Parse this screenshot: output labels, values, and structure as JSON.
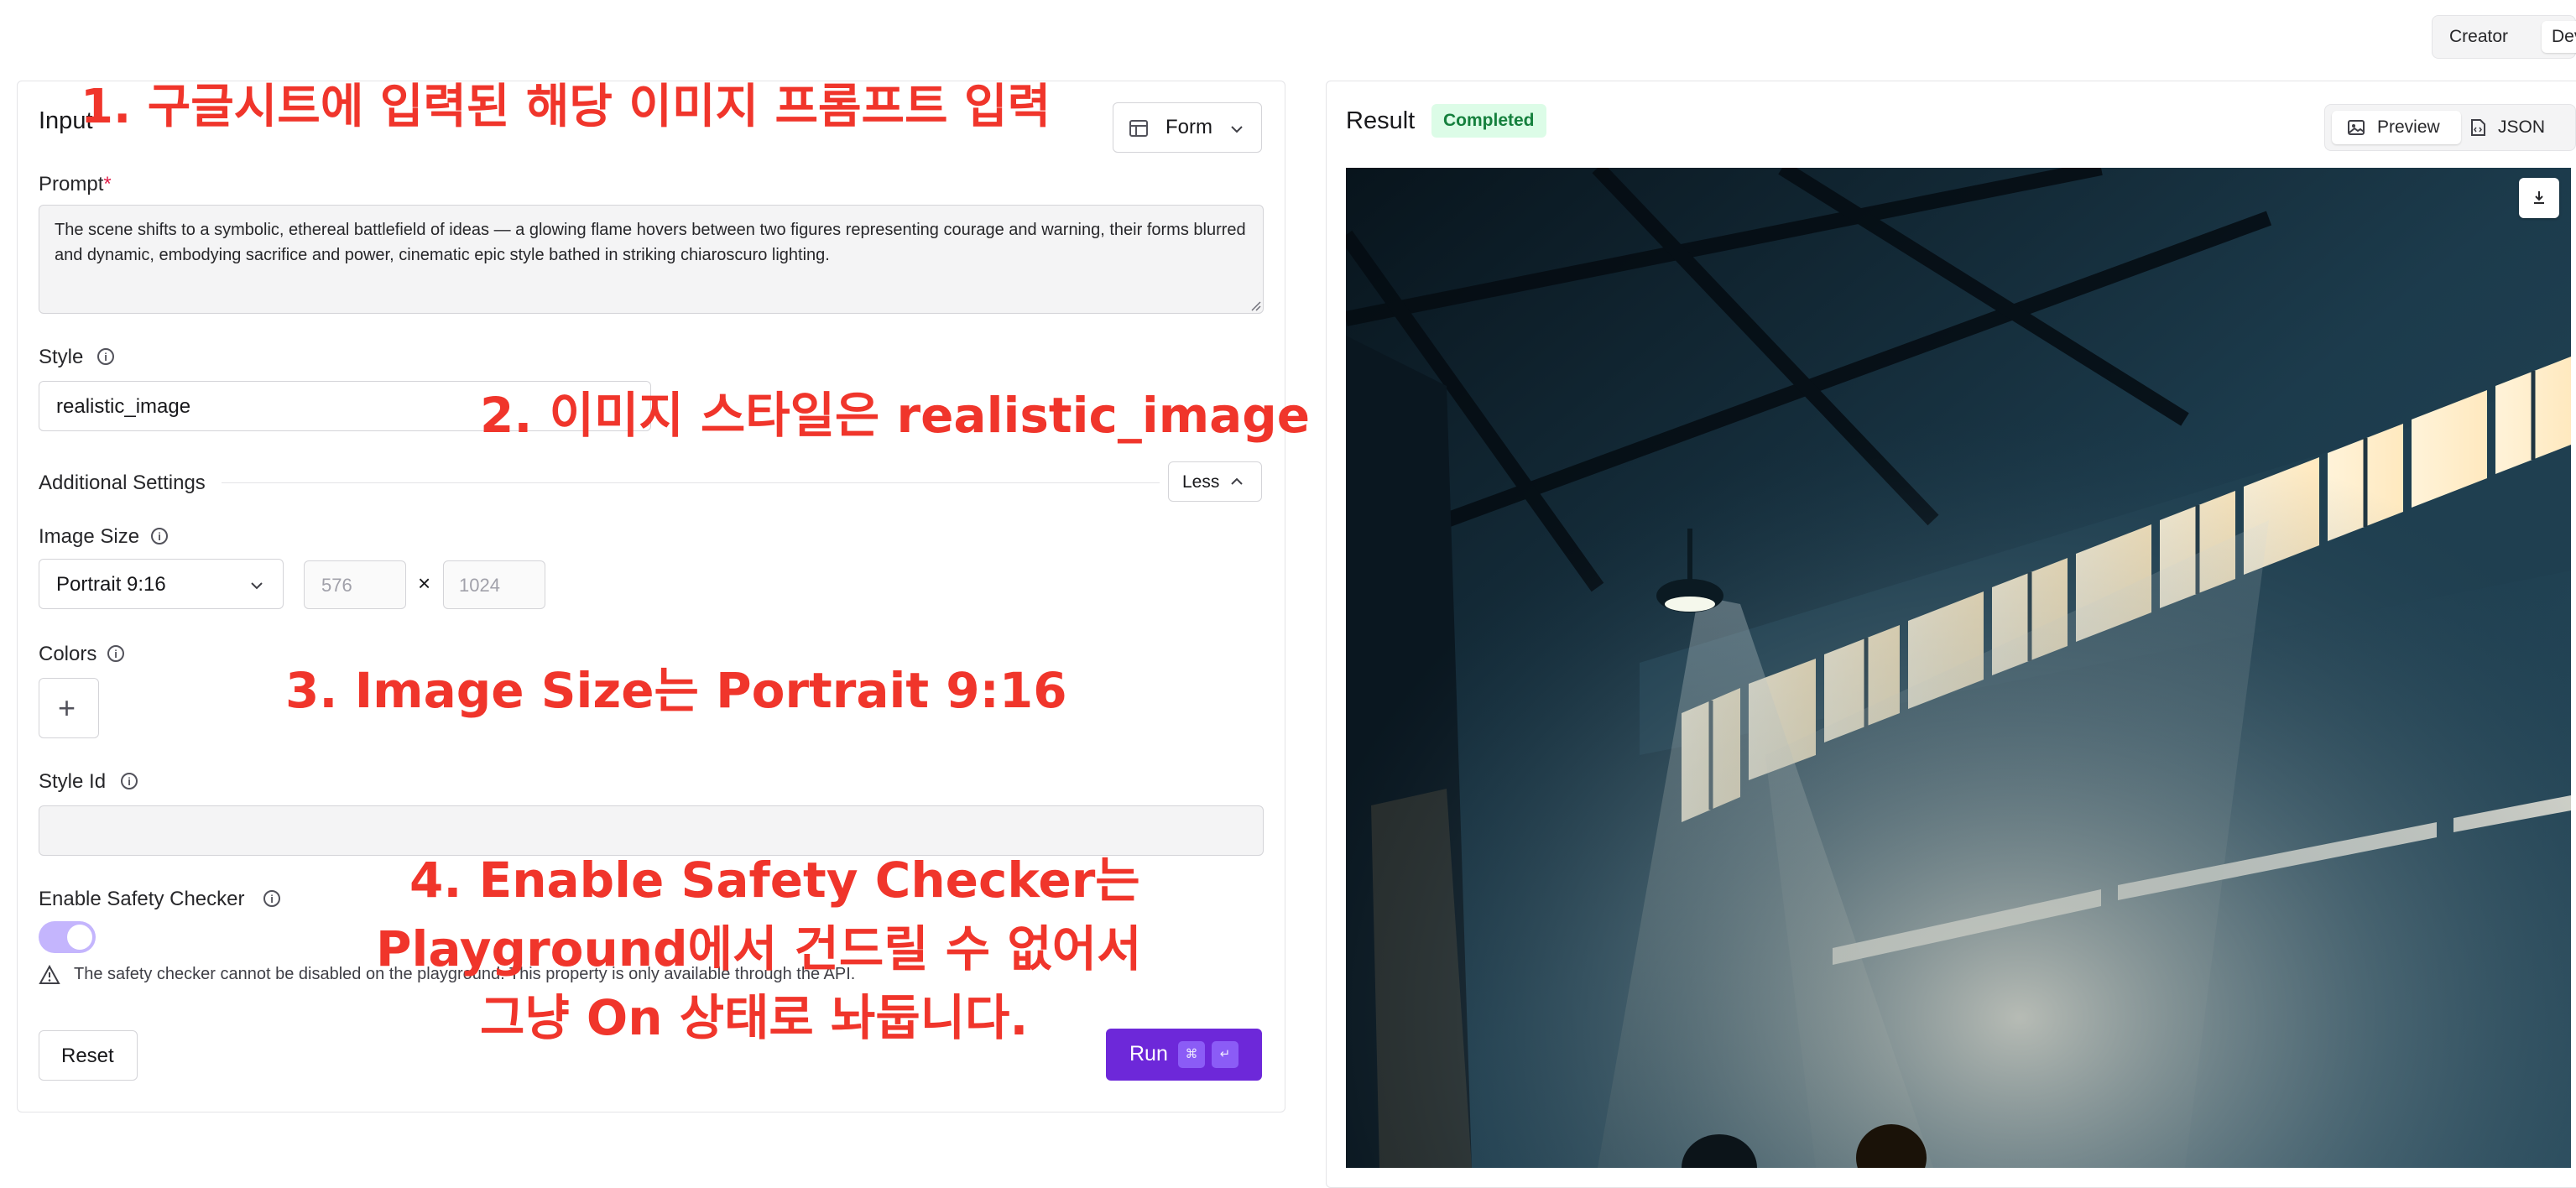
{
  "top_toggle": {
    "creator": "Creator",
    "dev": "Dev"
  },
  "input_panel": {
    "title": "Input",
    "form_select": "Form",
    "prompt_label": "Prompt",
    "required_mark": "*",
    "prompt_value": "The scene shifts to a symbolic, ethereal battlefield of ideas — a glowing flame hovers between two figures representing courage and warning, their forms blurred and dynamic, embodying sacrifice and power, cinematic epic style bathed in striking chiaroscuro lighting.",
    "style_label": "Style",
    "style_value": "realistic_image",
    "additional_settings_label": "Additional Settings",
    "less_button": "Less",
    "image_size_label": "Image Size",
    "image_size_value": "Portrait 9:16",
    "width_value": "576",
    "height_value": "1024",
    "times_sign": "×",
    "colors_label": "Colors",
    "add_color": "+",
    "style_id_label": "Style Id",
    "style_id_value": "",
    "safety_label": "Enable Safety Checker",
    "safety_enabled": true,
    "safety_note": "The safety checker cannot be disabled on the playground. This property is only available through the API.",
    "reset_button": "Reset",
    "run_button": "Run",
    "run_kbd_1": "⌘",
    "run_kbd_2": "↵"
  },
  "result_panel": {
    "title": "Result",
    "status_badge": "Completed",
    "preview_tab": "Preview",
    "json_tab": "JSON"
  },
  "annotations": {
    "a1": "1. 구글시트에 입력된 해당 이미지 프롬프트 입력",
    "a2": "2. 이미지 스타일은 realistic_image",
    "a3": "3. Image Size는 Portrait 9:16",
    "a4_line1": "4. Enable Safety Checker는",
    "a4_line2": "Playground에서 건드릴 수 없어서",
    "a4_line3": "그냥 On 상태로 놔둡니다."
  },
  "colors": {
    "accent": "#6d28d9",
    "toggle_on": "#c4b5fd",
    "success_bg": "#dcfce7",
    "success_text": "#15803d",
    "annotation": "#f0352b"
  }
}
